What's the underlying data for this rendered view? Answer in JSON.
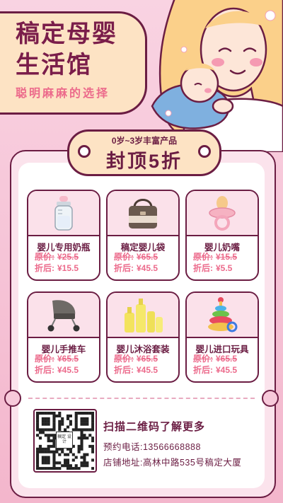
{
  "header": {
    "title_line1": "稿定母婴",
    "title_line2": "生活馆",
    "slogan": "聪明麻麻的选择"
  },
  "banner": {
    "subtitle": "0岁~3岁丰富产品",
    "headline": "封顶5折"
  },
  "price_labels": {
    "original": "原价:",
    "discounted": "折后:"
  },
  "products": [
    {
      "name": "婴儿专用奶瓶",
      "original_price": "¥25.5",
      "discount_price": "¥15.5",
      "icon": "baby-bottle-icon"
    },
    {
      "name": "稿定婴儿袋",
      "original_price": "¥65.5",
      "discount_price": "¥45.5",
      "icon": "diaper-bag-icon"
    },
    {
      "name": "婴儿奶嘴",
      "original_price": "¥15.5",
      "discount_price": "¥5.5",
      "icon": "pacifier-icon"
    },
    {
      "name": "婴儿手推车",
      "original_price": "¥65.5",
      "discount_price": "¥45.5",
      "icon": "stroller-icon"
    },
    {
      "name": "婴儿沐浴套装",
      "original_price": "¥65.5",
      "discount_price": "¥45.5",
      "icon": "bath-set-icon"
    },
    {
      "name": "婴儿进口玩具",
      "original_price": "¥65.5",
      "discount_price": "¥45.5",
      "icon": "stacking-toy-icon"
    }
  ],
  "footer": {
    "qr_caption": "扫描二维码了解更多",
    "phone": "预约电话:13566668888",
    "address": "店铺地址:高林中路535号稿定大厦",
    "qr_logo": "稿定 设计"
  },
  "colors": {
    "primary": "#6b1d43",
    "accent": "#ec6a8b",
    "cream": "#fde3c4",
    "background": "#f7c9da"
  }
}
